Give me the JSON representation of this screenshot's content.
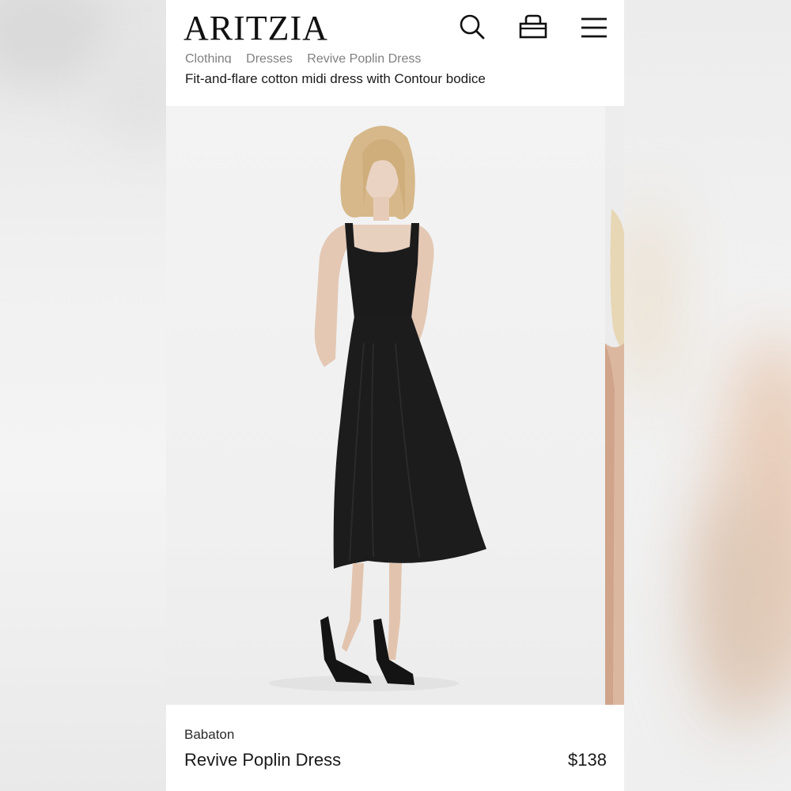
{
  "header": {
    "logo": "ARITZIA",
    "icons": {
      "search": "search-icon",
      "bag": "shopping-bag-icon",
      "menu": "menu-icon"
    }
  },
  "breadcrumb": {
    "items": [
      "Clothing",
      "Dresses",
      "Revive Poplin Dress"
    ]
  },
  "product": {
    "description": "Fit-and-flare cotton midi dress with Contour bodice",
    "brand": "Babaton",
    "name": "Revive Poplin Dress",
    "price": "$138"
  },
  "colors": {
    "text": "#1a1a1a",
    "background": "#ffffff",
    "dress": "#1b1b1b"
  }
}
